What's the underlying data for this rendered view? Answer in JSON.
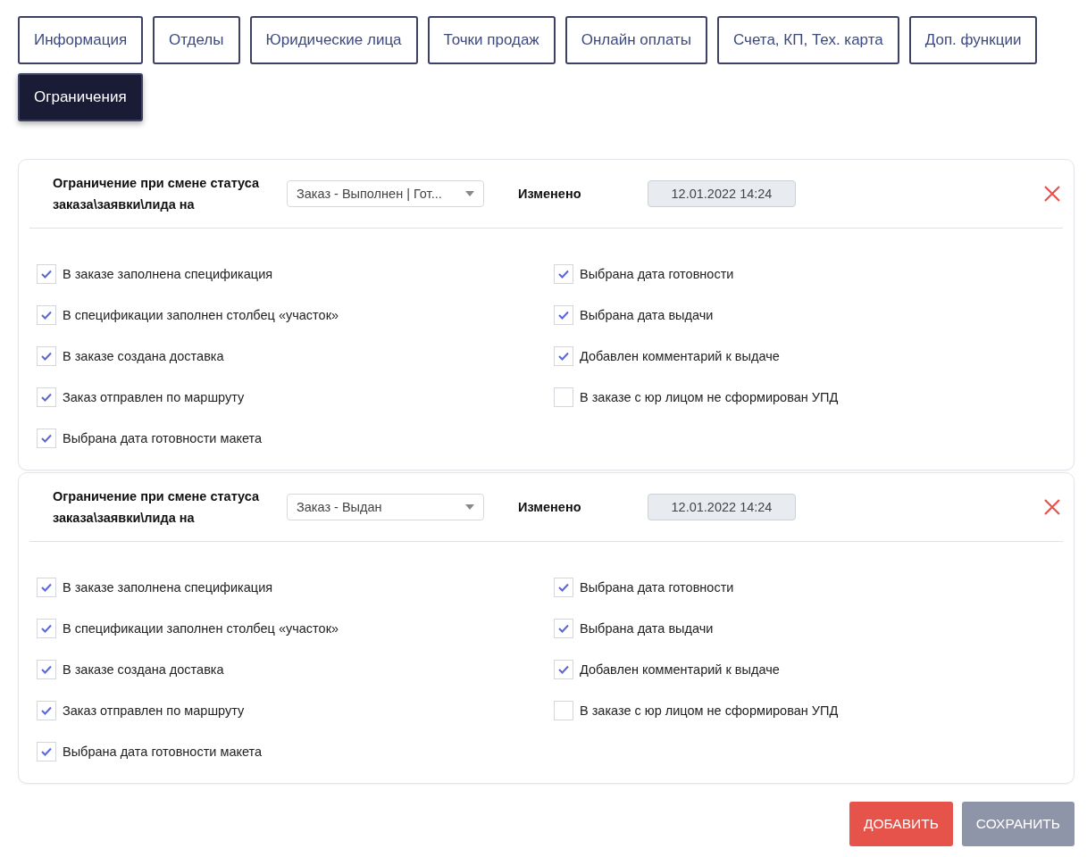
{
  "tabs": [
    {
      "label": "Информация",
      "selected": false
    },
    {
      "label": "Отделы",
      "selected": false
    },
    {
      "label": "Юридические лица",
      "selected": false
    },
    {
      "label": "Точки продаж",
      "selected": false
    },
    {
      "label": "Онлайн оплаты",
      "selected": false
    },
    {
      "label": "Счета, КП, Тех. карта",
      "selected": false
    },
    {
      "label": "Доп. функции",
      "selected": false
    },
    {
      "label": "Ограничения",
      "selected": true
    }
  ],
  "rules": [
    {
      "label": "Ограничение при смене статуса заказа\\заявки\\лида на",
      "status": "Заказ - Выполнен | Гот...",
      "changed_label": "Изменено",
      "changed_value": "12.01.2022 14:24",
      "conditions_left": [
        {
          "label": "В заказе заполнена спецификация",
          "checked": true
        },
        {
          "label": "В спецификации заполнен столбец «участок»",
          "checked": true
        },
        {
          "label": "В заказе создана доставка",
          "checked": true
        },
        {
          "label": "Заказ отправлен по маршруту",
          "checked": true
        },
        {
          "label": "Выбрана дата готовности макета",
          "checked": true
        }
      ],
      "conditions_right": [
        {
          "label": "Выбрана дата готовности",
          "checked": true
        },
        {
          "label": "Выбрана дата выдачи",
          "checked": true
        },
        {
          "label": "Добавлен комментарий к выдаче",
          "checked": true
        },
        {
          "label": "В заказе с юр лицом не сформирован УПД",
          "checked": false
        }
      ]
    },
    {
      "label": "Ограничение при смене статуса заказа\\заявки\\лида на",
      "status": "Заказ - Выдан",
      "changed_label": "Изменено",
      "changed_value": "12.01.2022 14:24",
      "conditions_left": [
        {
          "label": "В заказе заполнена спецификация",
          "checked": true
        },
        {
          "label": "В спецификации заполнен столбец «участок»",
          "checked": true
        },
        {
          "label": "В заказе создана доставка",
          "checked": true
        },
        {
          "label": "Заказ отправлен по маршруту",
          "checked": true
        },
        {
          "label": "Выбрана дата готовности макета",
          "checked": true
        }
      ],
      "conditions_right": [
        {
          "label": "Выбрана дата готовности",
          "checked": true
        },
        {
          "label": "Выбрана дата выдачи",
          "checked": true
        },
        {
          "label": "Добавлен комментарий к выдаче",
          "checked": true
        },
        {
          "label": "В заказе с юр лицом не сформирован УПД",
          "checked": false
        }
      ]
    }
  ],
  "buttons": [
    {
      "label": "ДОБАВИТЬ",
      "kind": "primary"
    },
    {
      "label": "СОХРАНИТЬ",
      "kind": "secondary"
    }
  ]
}
